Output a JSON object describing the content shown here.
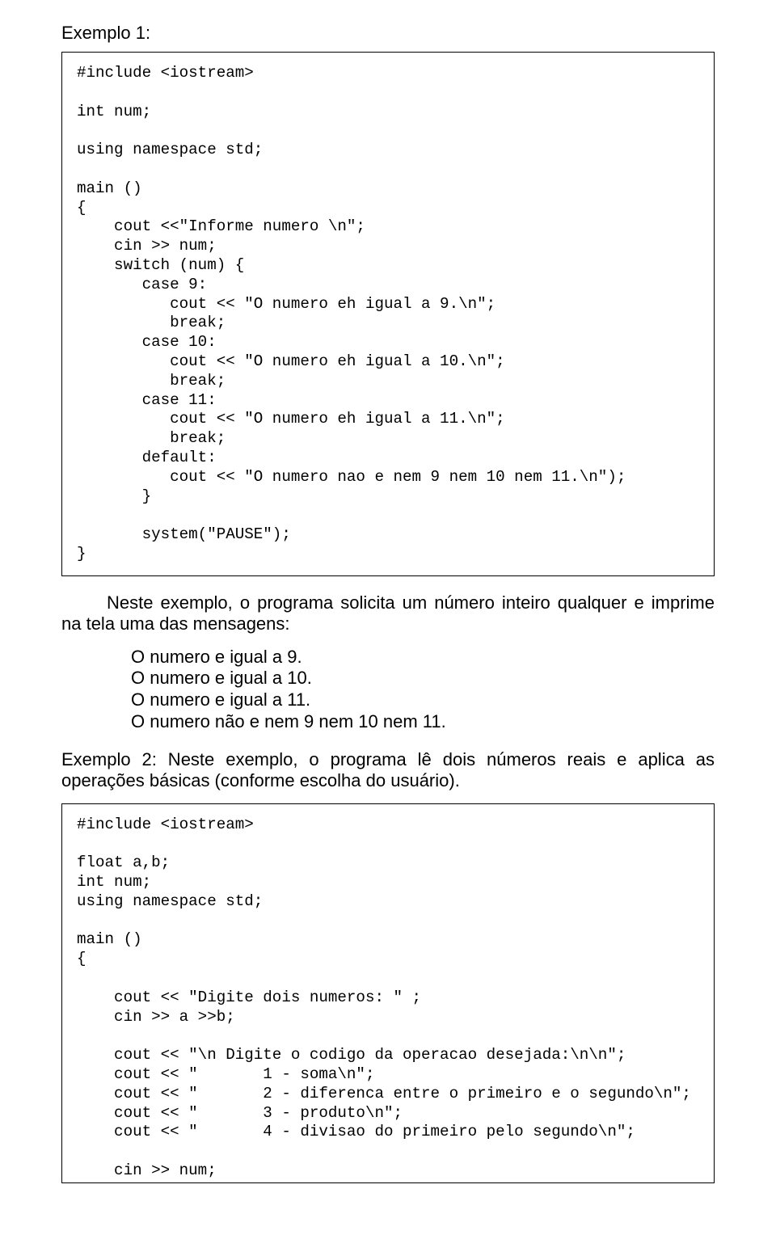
{
  "ex1_label": "Exemplo 1:",
  "code1": "#include <iostream>\n\nint num;\n\nusing namespace std;\n\nmain ()\n{\n    cout <<\"Informe numero \\n\";\n    cin >> num;\n    switch (num) {\n       case 9:\n          cout << \"O numero eh igual a 9.\\n\";\n          break;\n       case 10:\n          cout << \"O numero eh igual a 10.\\n\";\n          break;\n       case 11:\n          cout << \"O numero eh igual a 11.\\n\";\n          break;\n       default:\n          cout << \"O numero nao e nem 9 nem 10 nem 11.\\n\");\n       }\n\n       system(\"PAUSE\");\n}",
  "para1": "Neste exemplo, o programa solicita um número inteiro qualquer e imprime na tela uma das mensagens:",
  "list_items": [
    "O numero e igual a 9.",
    "O numero e igual a 10.",
    "O numero e igual a 11.",
    "O numero não e nem 9 nem 10 nem 11."
  ],
  "para2": "Exemplo 2: Neste exemplo, o programa lê dois números reais e aplica as operações básicas (conforme escolha do usuário).",
  "code2": "#include <iostream>\n\nfloat a,b;\nint num;\nusing namespace std;\n\nmain ()\n{\n\n    cout << \"Digite dois numeros: \" ;\n    cin >> a >>b;\n\n    cout << \"\\n Digite o codigo da operacao desejada:\\n\\n\";\n    cout << \"       1 - soma\\n\";\n    cout << \"       2 - diferenca entre o primeiro e o segundo\\n\";\n    cout << \"       3 - produto\\n\";\n    cout << \"       4 - divisao do primeiro pelo segundo\\n\";\n\n    cin >> num;"
}
